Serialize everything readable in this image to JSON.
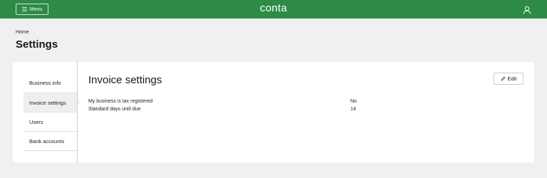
{
  "header": {
    "menu_label": "Menu",
    "logo_text": "conta",
    "brand_color": "#2e8b46"
  },
  "breadcrumb": {
    "home": "Home"
  },
  "page": {
    "title": "Settings"
  },
  "sidebar": {
    "items": [
      {
        "label": "Business info",
        "active": false
      },
      {
        "label": "Invoice settings",
        "active": true
      },
      {
        "label": "Users",
        "active": false
      },
      {
        "label": "Bank accounts",
        "active": false
      }
    ]
  },
  "section": {
    "title": "Invoice settings",
    "edit_label": "Edit",
    "rows": [
      {
        "label": "My business is tax registered",
        "value": "No"
      },
      {
        "label": "Standard days until due",
        "value": "14"
      }
    ]
  },
  "icons": {
    "menu": "hamburger-icon",
    "user": "user-icon",
    "edit": "pencil-icon"
  }
}
